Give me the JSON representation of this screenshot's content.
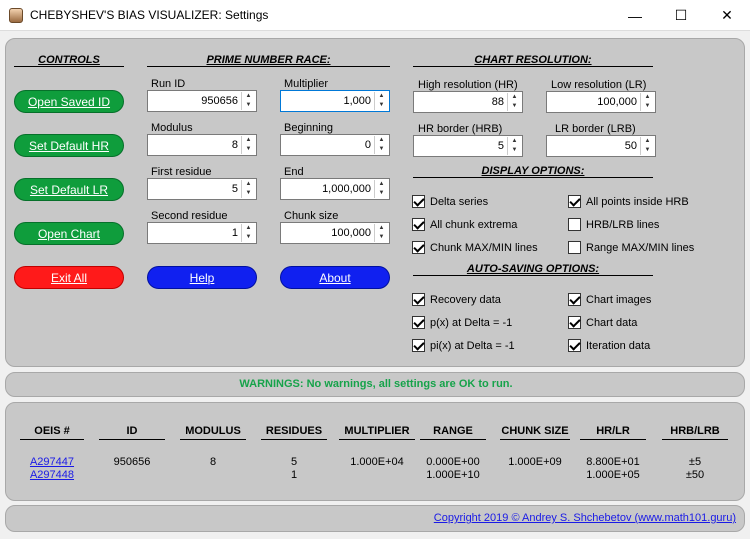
{
  "window": {
    "title": "CHEBYSHEV'S BIAS VISUALIZER: Settings",
    "minimize": "—",
    "maximize": "☐",
    "close": "✕"
  },
  "controls": {
    "heading": "CONTROLS",
    "open_saved_id": "Open Saved ID",
    "set_default_hr": "Set Default HR",
    "set_default_lr": "Set Default LR",
    "open_chart": "Open Chart",
    "exit_all": "Exit All"
  },
  "race": {
    "heading": "PRIME NUMBER RACE:",
    "run_id_label": "Run ID",
    "run_id": "950656",
    "multiplier_label": "Multiplier",
    "multiplier": "1,000",
    "modulus_label": "Modulus",
    "modulus": "8",
    "beginning_label": "Beginning",
    "beginning": "0",
    "first_residue_label": "First residue",
    "first_residue": "5",
    "end_label": "End",
    "end": "1,000,000",
    "second_residue_label": "Second residue",
    "second_residue": "1",
    "chunk_size_label": "Chunk size",
    "chunk_size": "100,000",
    "help": "Help",
    "about": "About"
  },
  "resolution": {
    "heading": "CHART RESOLUTION:",
    "hr_label": "High resolution (HR)",
    "hr": "88",
    "lr_label": "Low resolution (LR)",
    "lr": "100,000",
    "hrb_label": "HR border (HRB)",
    "hrb": "5",
    "lrb_label": "LR border (LRB)",
    "lrb": "50"
  },
  "display": {
    "heading": "DISPLAY OPTIONS:",
    "delta_series": "Delta series",
    "all_points_inside_hrb": "All points inside HRB",
    "all_chunk_extrema": "All chunk extrema",
    "hrb_lrb_lines": "HRB/LRB lines",
    "chunk_maxmin_lines": "Chunk MAX/MIN lines",
    "range_maxmin_lines": "Range MAX/MIN lines"
  },
  "autosave": {
    "heading": "AUTO-SAVING OPTIONS:",
    "recovery_data": "Recovery data",
    "chart_images": "Chart images",
    "px_at_delta": "p(x) at Delta = -1",
    "chart_data": "Chart data",
    "pix_at_delta": "pi(x) at Delta = -1",
    "iteration_data": "Iteration data"
  },
  "warnings": "WARNINGS: No warnings, all settings are OK to run.",
  "table": {
    "headers": [
      "OEIS #",
      "ID",
      "MODULUS",
      "RESIDUES",
      "MULTIPLIER",
      "RANGE",
      "CHUNK SIZE",
      "HR/LR",
      "HRB/LRB"
    ],
    "row1": [
      "A297447",
      "950656",
      "8",
      "5",
      "1.000E+04",
      "0.000E+00",
      "1.000E+09",
      "8.800E+01",
      "±5"
    ],
    "row2": [
      "A297448",
      "",
      "",
      "1",
      "",
      "1.000E+10",
      "",
      "1.000E+05",
      "±50"
    ]
  },
  "copyright": "Copyright 2019 © Andrey S. Shchebetov (www.math101.guru)"
}
